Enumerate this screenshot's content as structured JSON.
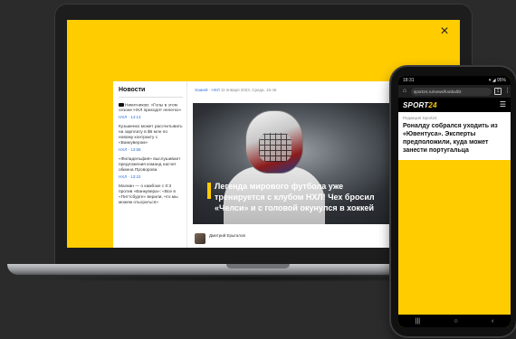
{
  "colors": {
    "accent": "#ffcc00",
    "background": "#2b2b2b",
    "link": "#2f6fd1"
  },
  "popup": {
    "close_label": "×"
  },
  "laptop": {
    "news": {
      "title": "Новости",
      "items": [
        {
          "icon": "video-icon",
          "text": "Никитников: «Голы в этом сезоне НХЛ приходят нелегко»",
          "meta": "НХЛ · 14:13"
        },
        {
          "text": "Кузьменко может рассчитывать на зарплату в $6 млн по новому контракту с «Ванкувером»",
          "meta": "НХЛ · 13:58"
        },
        {
          "text": "«Филадельфия» выслушивает предложения команд насчет обмена Проворова",
          "meta": "НХЛ · 13:22"
        },
        {
          "text": "Малкин — о камбэке с 0:3 против «Ванкувера»: «Все в «Питтсбурге» верили, что мы можем отыграться»",
          "meta": ""
        }
      ]
    },
    "article": {
      "rubric": "Хоккей · НХЛ",
      "date": "11 января 2023, Среда, 16:46",
      "headline": "Легенда мирового футбола уже тренируется с клубом НХЛ! Чех бросил «Челси» и с головой окунулся в хоккей",
      "author": "Дмитрий Ерыгалов",
      "share_icon": "share-icon"
    }
  },
  "phone": {
    "status": {
      "time": "18:31",
      "right": "▾ ◢ 95%"
    },
    "url": "sport24.ru/news/football/2",
    "tabs": "1",
    "logo_text": "SPORT",
    "logo_num": "24",
    "rubric": "Редакция Sport24",
    "headline": "Роналду собрался уходить из «Ювентуса». Эксперты предположили, куда может занести португальца",
    "nav": {
      "back": "‹",
      "home": "○",
      "recent": "|||"
    }
  }
}
